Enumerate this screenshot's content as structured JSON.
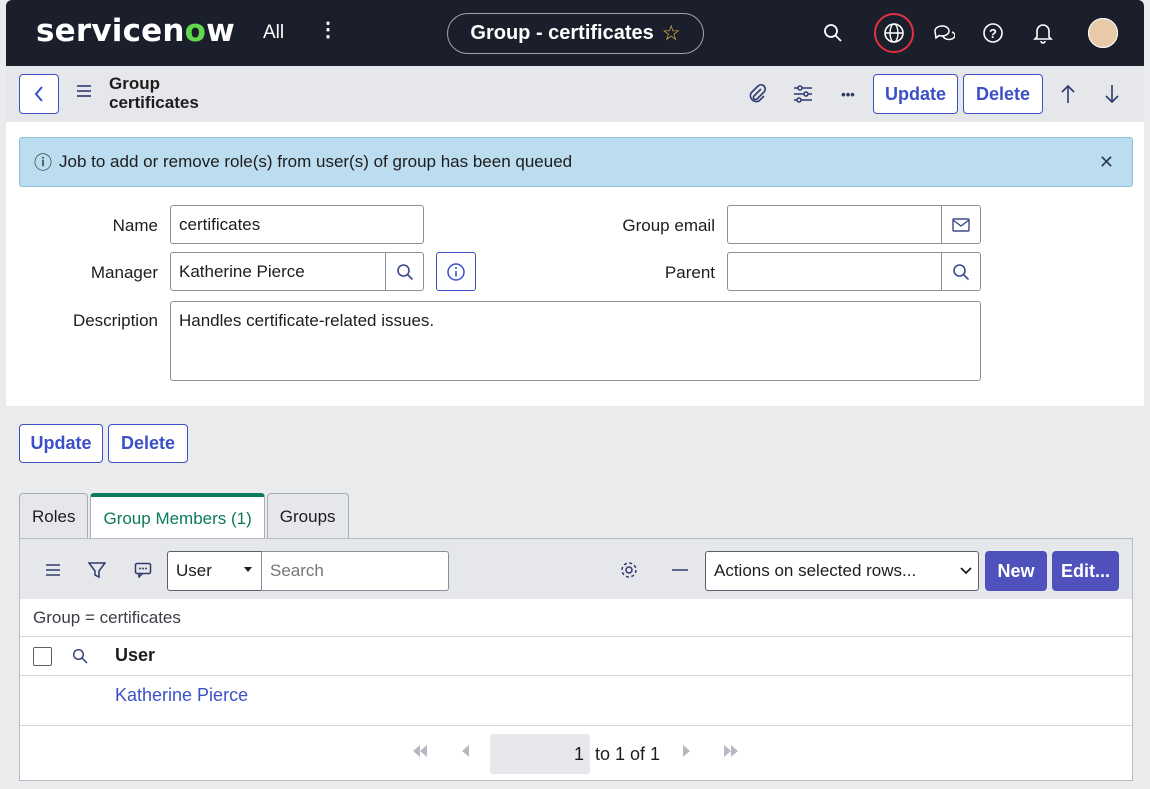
{
  "nav": {
    "logo_text_a": "servicen",
    "logo_text_o": "o",
    "logo_text_b": "w",
    "all_label": "All",
    "more_glyph": "⋮",
    "record_title": "Group - certificates",
    "star_glyph": "☆",
    "icons": [
      "search-icon",
      "globe-icon",
      "chat-icon",
      "help-icon",
      "bell-icon",
      "avatar"
    ]
  },
  "header": {
    "title": "Group certificates",
    "update_label": "Update",
    "delete_label": "Delete",
    "more_glyph": "•••"
  },
  "alert": {
    "message": "Job to add or remove role(s) from user(s) of group has been queued",
    "info_glyph": "ⓘ",
    "close_glyph": "✕"
  },
  "form": {
    "name_label": "Name",
    "name_value": "certificates",
    "manager_label": "Manager",
    "manager_value": "Katherine Pierce",
    "description_label": "Description",
    "description_value": "Handles certificate-related issues.",
    "group_email_label": "Group email",
    "group_email_value": "",
    "parent_label": "Parent",
    "parent_value": ""
  },
  "bottom_buttons": {
    "update_label": "Update",
    "delete_label": "Delete"
  },
  "tabs": [
    {
      "label": "Roles",
      "active": false
    },
    {
      "label": "Group Members (1)",
      "active": true
    },
    {
      "label": "Groups",
      "active": false
    }
  ],
  "list": {
    "search_field_selected": "User",
    "search_placeholder": "Search",
    "actions_selected": "Actions on selected rows...",
    "new_label": "New",
    "edit_label": "Edit...",
    "filter_text": "Group = certificates",
    "column_header": "User",
    "rows": [
      {
        "user": "Katherine Pierce"
      }
    ],
    "pager": {
      "current": "1",
      "summary": "to 1 of 1"
    }
  }
}
